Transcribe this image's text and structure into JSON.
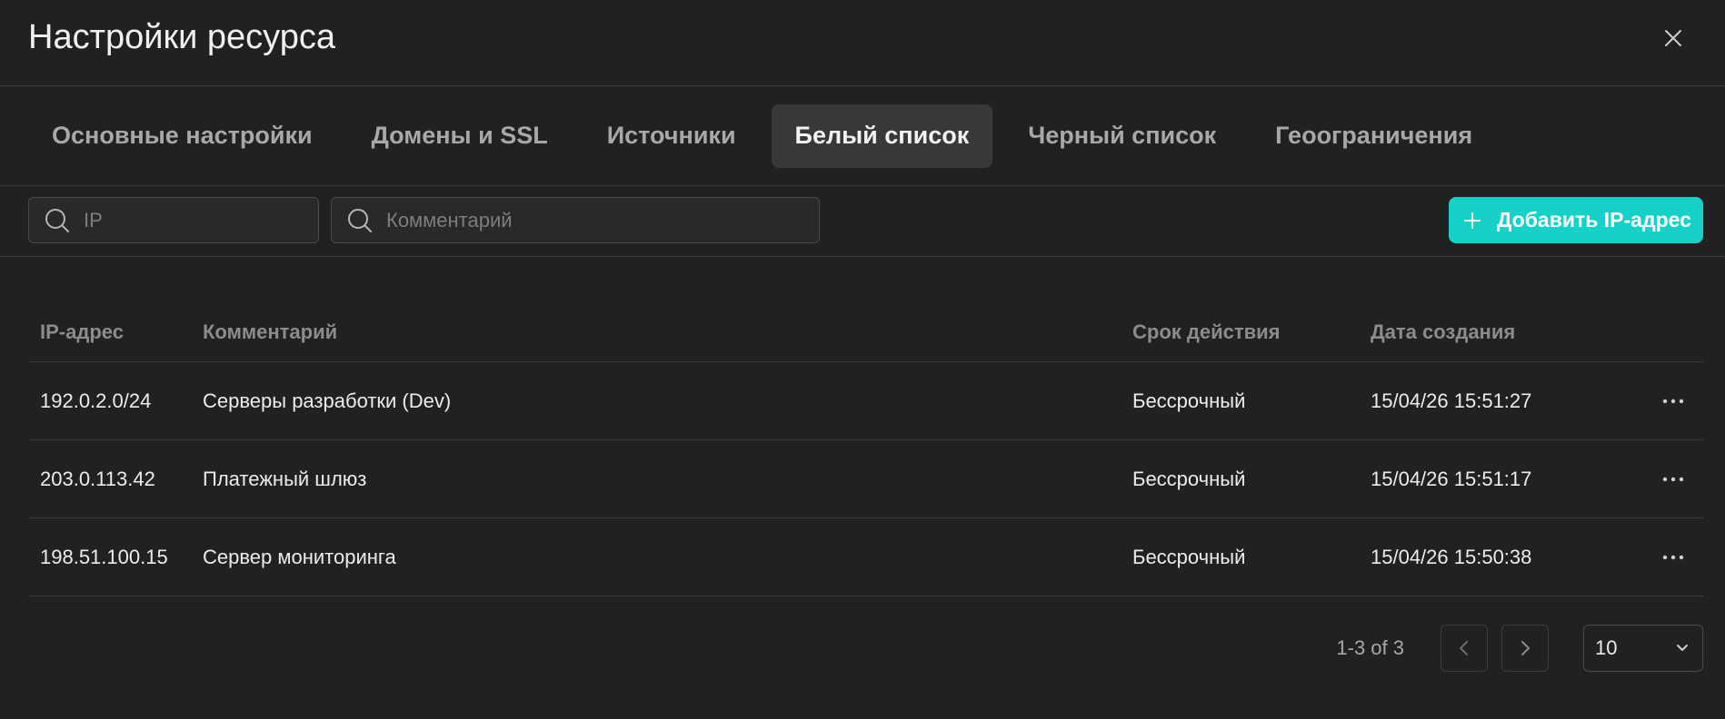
{
  "dialog": {
    "title": "Настройки ресурса"
  },
  "tabs": [
    {
      "label": "Основные настройки",
      "active": false
    },
    {
      "label": "Домены и SSL",
      "active": false
    },
    {
      "label": "Источники",
      "active": false
    },
    {
      "label": "Белый список",
      "active": true
    },
    {
      "label": "Черный список",
      "active": false
    },
    {
      "label": "Геоограничения",
      "active": false
    }
  ],
  "filters": {
    "ip_placeholder": "IP",
    "comment_placeholder": "Комментарий",
    "add_button_label": "Добавить IP-адрес"
  },
  "table": {
    "headers": {
      "ip": "IP-адрес",
      "comment": "Комментарий",
      "expiration": "Срок действия",
      "created": "Дата создания"
    },
    "rows": [
      {
        "ip": "192.0.2.0/24",
        "comment": "Серверы разработки (Dev)",
        "expiration": "Бессрочный",
        "created": "15/04/26 15:51:27"
      },
      {
        "ip": "203.0.113.42",
        "comment": "Платежный шлюз",
        "expiration": "Бессрочный",
        "created": "15/04/26 15:51:17"
      },
      {
        "ip": "198.51.100.15",
        "comment": "Сервер мониторинга",
        "expiration": "Бессрочный",
        "created": "15/04/26 15:50:38"
      }
    ]
  },
  "pagination": {
    "range_text": "1-3 of 3",
    "page_size": "10"
  },
  "colors": {
    "accent": "#16d1c7",
    "background": "#212121",
    "active_tab_bg": "#383838"
  },
  "icons": {
    "close": "close-icon",
    "search": "search-icon",
    "plus": "plus-icon",
    "more": "more-horizontal-icon",
    "prev": "chevron-left-icon",
    "next": "chevron-right-icon",
    "dropdown": "chevron-down-icon"
  }
}
